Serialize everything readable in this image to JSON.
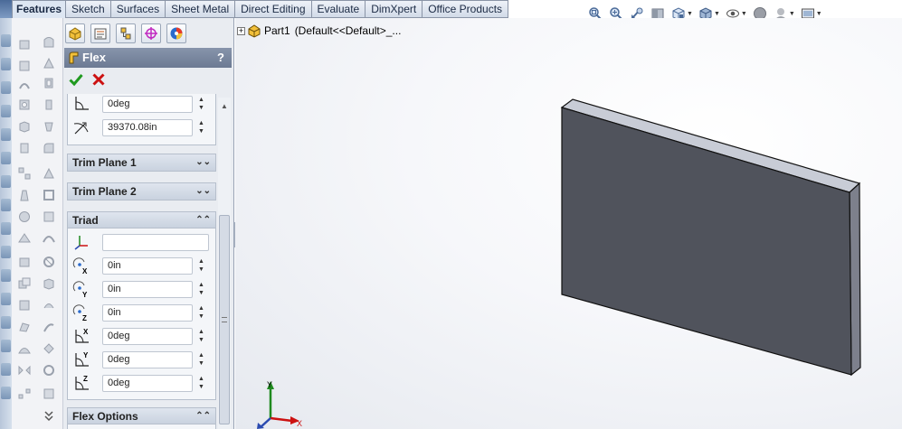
{
  "tabs": {
    "features": "Features",
    "sketch": "Sketch",
    "surfaces": "Surfaces",
    "sheet_metal": "Sheet Metal",
    "direct_editing": "Direct Editing",
    "evaluate": "Evaluate",
    "dimxpert": "DimXpert",
    "office_products": "Office Products"
  },
  "toolbar_icons": [
    "zoom-to-fit-icon",
    "zoom-to-area-icon",
    "previous-view-icon",
    "section-view-icon",
    "view-orientation-icon",
    "display-style-icon",
    "hide-show-items-icon",
    "edit-appearance-icon",
    "apply-scene-icon",
    "view-settings-icon"
  ],
  "property_manager": {
    "title": "Flex",
    "help": "?",
    "top_fields": [
      {
        "icon": "bend-angle-icon",
        "value": "0deg"
      },
      {
        "icon": "radius-icon",
        "value": "39370.08in"
      }
    ],
    "groups": {
      "trim_plane_1": "Trim Plane 1",
      "trim_plane_2": "Trim Plane 2",
      "triad": "Triad",
      "flex_options": "Flex Options"
    },
    "triad_fields": [
      {
        "icon": "triad-selection-icon",
        "value": ""
      },
      {
        "icon": "x-rotation-origin-icon",
        "value": "0in"
      },
      {
        "icon": "y-rotation-origin-icon",
        "value": "0in"
      },
      {
        "icon": "z-rotation-origin-icon",
        "value": "0in"
      },
      {
        "icon": "x-rotation-angle-icon",
        "value": "0deg"
      },
      {
        "icon": "y-rotation-angle-icon",
        "value": "0deg"
      },
      {
        "icon": "z-rotation-angle-icon",
        "value": "0deg"
      }
    ]
  },
  "tree": {
    "part_label": "Part1",
    "config_label": "(Default<<Default>_..."
  },
  "triad_labels": {
    "x": "X",
    "y": "Y"
  },
  "colors": {
    "part_front": "#50535c",
    "part_top": "#c8ccd6",
    "part_side": "#7d808c",
    "title_bar": "#7a879f",
    "ok_green": "#1f9a1f",
    "cancel_red": "#cc1111"
  }
}
